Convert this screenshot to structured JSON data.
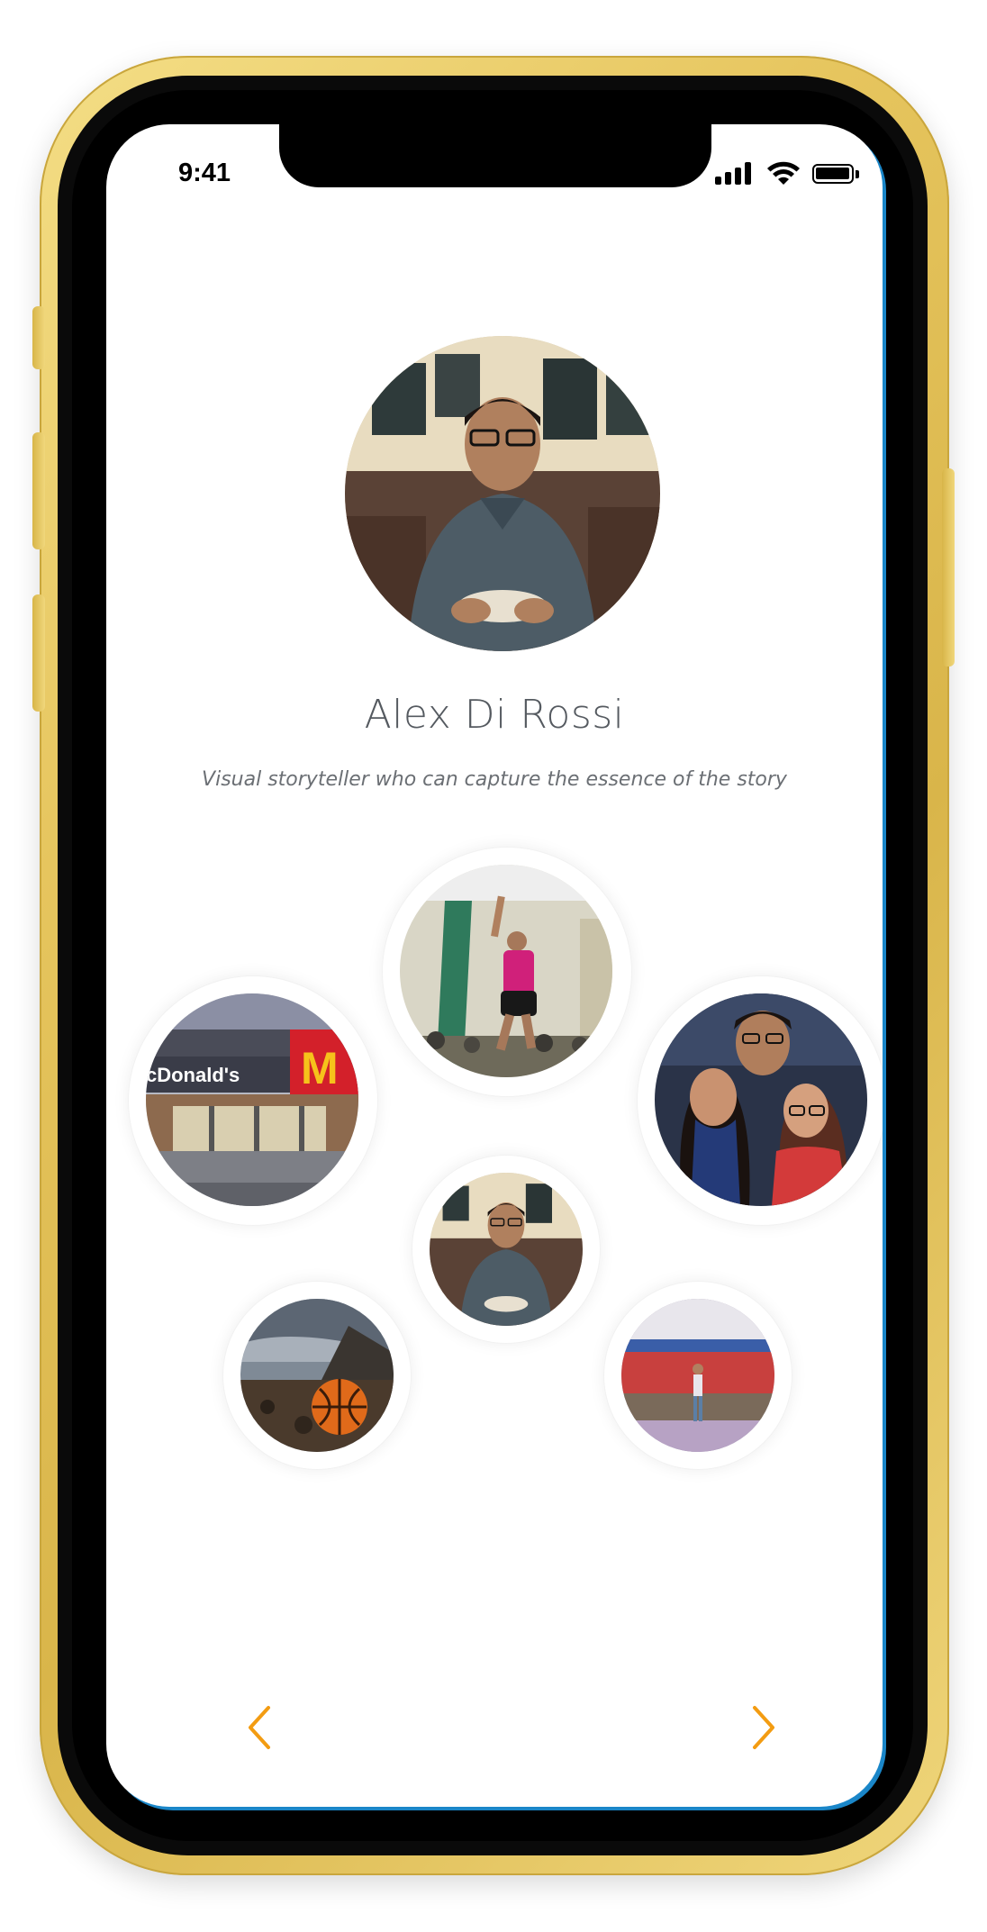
{
  "status_bar": {
    "time": "9:41",
    "signal_bars": 4,
    "battery_level": 1.0
  },
  "profile": {
    "name": "Alex Di Rossi",
    "tagline": "Visual storyteller who can capture the essence of the story",
    "avatar_icon": "profile-photo"
  },
  "photo_bubbles": [
    {
      "name": "basketball-dunk-photo",
      "sign_text": ""
    },
    {
      "name": "restaurant-storefront-photo",
      "sign_text": "cDonald's"
    },
    {
      "name": "friends-selfie-photo",
      "sign_text": ""
    },
    {
      "name": "profile-thumbnail-photo",
      "sign_text": ""
    },
    {
      "name": "basketball-sunset-photo",
      "sign_text": ""
    },
    {
      "name": "court-wall-photo",
      "sign_text": ""
    }
  ],
  "navigation": {
    "prev_icon": "chevron-left-icon",
    "next_icon": "chevron-right-icon"
  },
  "colors": {
    "accent": "#f39c12",
    "name_text": "#555a60",
    "tagline_text": "#6b6f74",
    "frame_gold": "#e6c55e",
    "screen_edge": "#1a86c8"
  }
}
